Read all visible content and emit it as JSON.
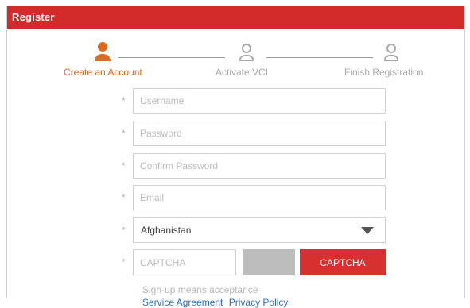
{
  "window": {
    "title": "Register"
  },
  "steps": [
    {
      "label": "Create an Account",
      "state": "active",
      "icon": "user-icon"
    },
    {
      "label": "Activate VCI",
      "state": "inactive",
      "icon": "user-icon"
    },
    {
      "label": "Finish Registration",
      "state": "inactive",
      "icon": "user-icon"
    }
  ],
  "form": {
    "required_marker": "*",
    "username": {
      "placeholder": "Username",
      "value": ""
    },
    "password": {
      "placeholder": "Password",
      "value": ""
    },
    "confirm_password": {
      "placeholder": "Confirm Password",
      "value": ""
    },
    "email": {
      "placeholder": "Email",
      "value": ""
    },
    "country": {
      "selected": "Afghanistan"
    },
    "captcha": {
      "placeholder": "CAPTCHA",
      "button_label": "CAPTCHA"
    }
  },
  "footer": {
    "terms_text": "Sign-up means acceptance",
    "service_agreement": "Service Agreement",
    "privacy_policy": "Privacy Policy"
  },
  "colors": {
    "brand_red": "#d32a2a",
    "active_step": "#e06a1b",
    "inactive_step": "#a9a9a9",
    "link": "#2f6fc0"
  }
}
